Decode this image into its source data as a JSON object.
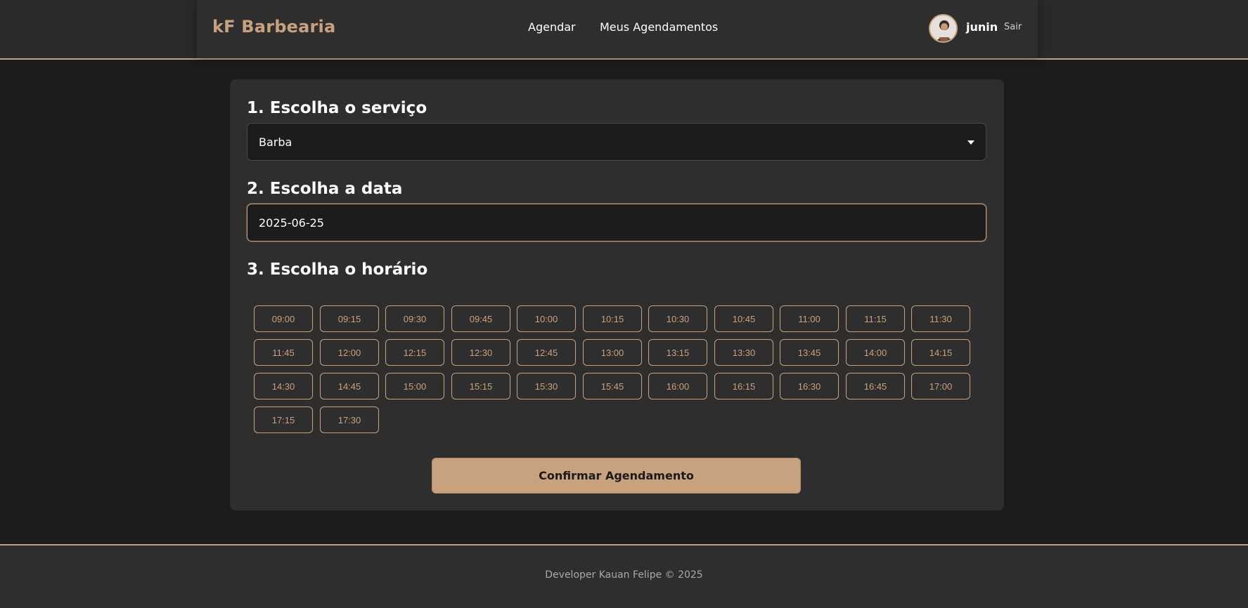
{
  "header": {
    "brand": "kF Barbearia",
    "nav": [
      {
        "label": "Agendar"
      },
      {
        "label": "Meus Agendamentos"
      }
    ],
    "user": {
      "name": "junin",
      "logout_label": "Sair"
    }
  },
  "form": {
    "service": {
      "title": "1. Escolha o serviço",
      "selected": "Barba"
    },
    "date": {
      "title": "2. Escolha a data",
      "value": "2025-06-25"
    },
    "time": {
      "title": "3. Escolha o horário",
      "slots": [
        "09:00",
        "09:15",
        "09:30",
        "09:45",
        "10:00",
        "10:15",
        "10:30",
        "10:45",
        "11:00",
        "11:15",
        "11:30",
        "11:45",
        "12:00",
        "12:15",
        "12:30",
        "12:45",
        "13:00",
        "13:15",
        "13:30",
        "13:45",
        "14:00",
        "14:15",
        "14:30",
        "14:45",
        "15:00",
        "15:15",
        "15:30",
        "15:45",
        "16:00",
        "16:15",
        "16:30",
        "16:45",
        "17:00",
        "17:15",
        "17:30"
      ]
    },
    "confirm_label": "Confirmar Agendamento"
  },
  "footer": {
    "text": "Developer Kauan Felipe © 2025"
  },
  "colors": {
    "accent": "#c8a27e",
    "background": "#1c1c1c",
    "card": "#2e2e2e"
  }
}
